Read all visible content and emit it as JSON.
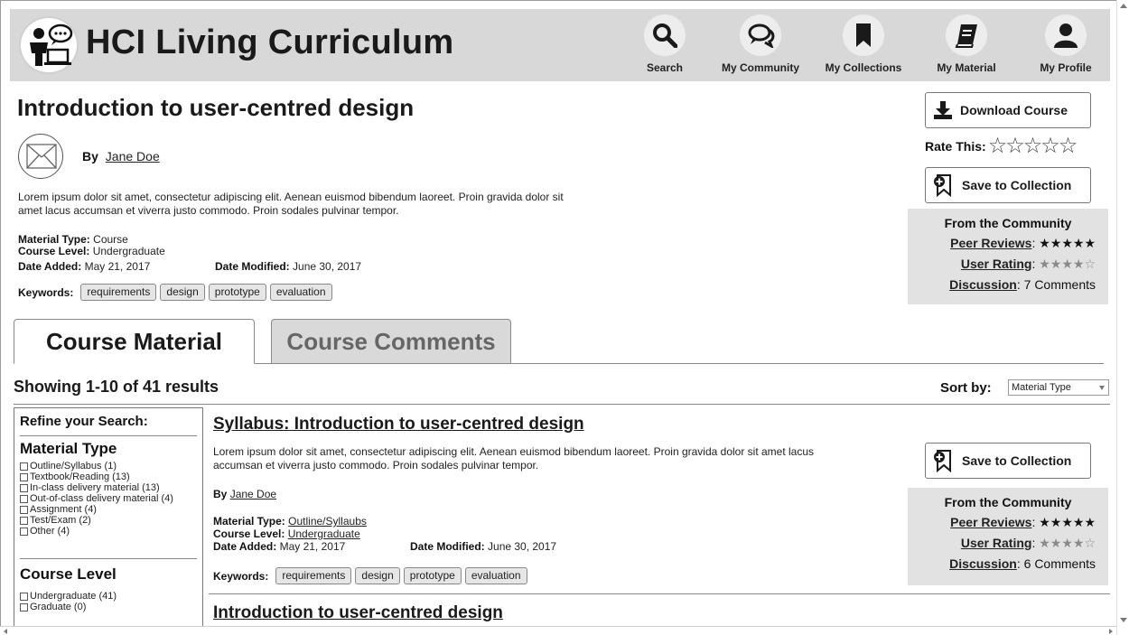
{
  "header": {
    "title": "HCI Living Curriculum",
    "nav": [
      {
        "label": "Search",
        "icon": "search-icon"
      },
      {
        "label": "My Community",
        "icon": "chat-bubbles-icon"
      },
      {
        "label": "My Collections",
        "icon": "bookmark-icon"
      },
      {
        "label": "My Material",
        "icon": "book-icon"
      },
      {
        "label": "My Profile",
        "icon": "person-icon"
      }
    ]
  },
  "course": {
    "title": "Introduction to user-centred design",
    "by_label": "By",
    "author": "Jane Doe",
    "description": "Lorem ipsum dolor sit amet, consectetur adipiscing elit. Aenean euismod bibendum laoreet. Proin gravida dolor sit amet lacus accumsan et viverra justo commodo. Proin sodales pulvinar tempor.",
    "material_type_label": "Material Type:",
    "material_type": "Course",
    "course_level_label": "Course Level:",
    "course_level": "Undergraduate",
    "date_added_label": "Date Added:",
    "date_added": "May 21, 2017",
    "date_modified_label": "Date Modified:",
    "date_modified": "June 30, 2017",
    "keywords_label": "Keywords:",
    "keywords": [
      "requirements",
      "design",
      "prototype",
      "evaluation"
    ]
  },
  "actions": {
    "download": "Download Course",
    "rate_label": "Rate This:",
    "rate_stars": "☆☆☆☆☆",
    "save": "Save to Collection"
  },
  "community": {
    "title": "From the Community",
    "peer_reviews_label": "Peer Reviews",
    "peer_stars": "★★★★★",
    "user_rating_label": "User Rating",
    "user_stars": "★★★★☆",
    "discussion_label": "Discussion",
    "discussion_count": "7 Comments"
  },
  "tabs": {
    "active": "Course Material",
    "inactive": "Course Comments"
  },
  "results": {
    "showing": "Showing 1-10 of 41 results",
    "sort_label": "Sort by:",
    "sort_value": "Material Type"
  },
  "refine": {
    "title": "Refine your Search:",
    "material_type_title": "Material Type",
    "material_types": [
      "Outline/Syllabus (1)",
      "Textbook/Reading (13)",
      "In-class delivery material (13)",
      "Out-of-class delivery material (4)",
      "Assignment (4)",
      "Test/Exam (2)",
      "Other (4)"
    ],
    "course_level_title": "Course Level",
    "course_levels": [
      "Undergraduate (41)",
      "Graduate (0)"
    ]
  },
  "result1": {
    "title": "Syllabus: Introduction to user-centred design",
    "description": "Lorem ipsum dolor sit amet, consectetur adipiscing elit. Aenean euismod bibendum laoreet. Proin gravida dolor sit amet lacus accumsan et viverra justo commodo. Proin sodales pulvinar tempor.",
    "by_label": "By",
    "author": "Jane Doe",
    "material_type_label": "Material Type:",
    "material_type": "Outline/Syllaubs",
    "course_level_label": "Course Level:",
    "course_level": "Undergraduate",
    "date_added_label": "Date Added:",
    "date_added": "May 21, 2017",
    "date_modified_label": "Date Modified:",
    "date_modified": "June 30, 2017",
    "keywords_label": "Keywords:",
    "keywords": [
      "requirements",
      "design",
      "prototype",
      "evaluation"
    ],
    "save": "Save to Collection",
    "community_title": "From the Community",
    "peer_reviews_label": "Peer Reviews",
    "peer_stars": "★★★★★",
    "user_rating_label": "User Rating",
    "user_stars": "★★★★☆",
    "discussion_label": "Discussion",
    "discussion_count": "6 Comments"
  },
  "result2": {
    "title": "Introduction to user-centred design"
  }
}
